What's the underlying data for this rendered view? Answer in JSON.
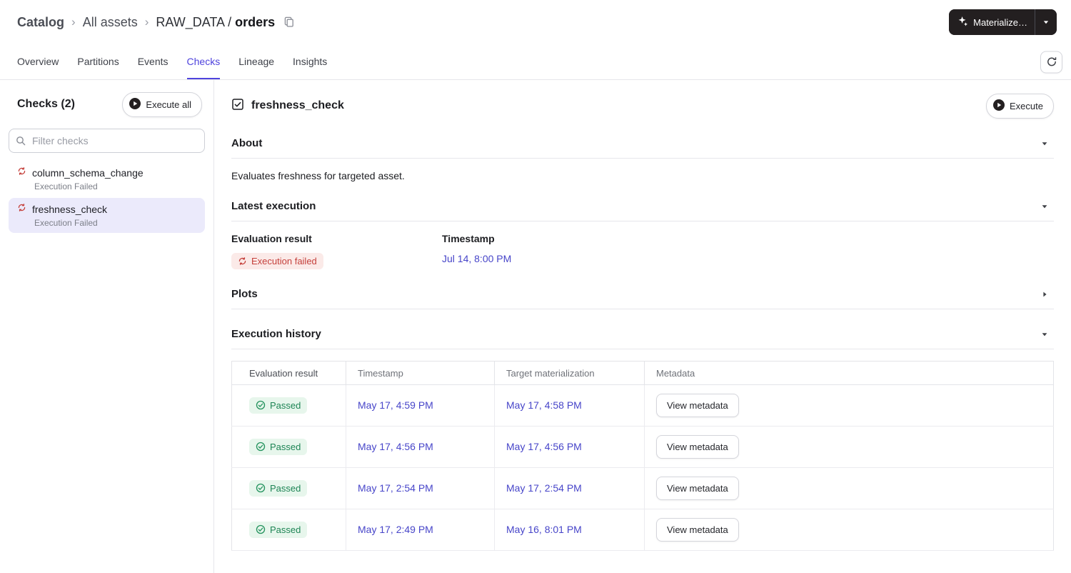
{
  "breadcrumb": {
    "catalog": "Catalog",
    "all_assets": "All assets",
    "asset_prefix": "RAW_DATA /",
    "asset_name": "orders"
  },
  "header": {
    "materialize_label": "Materialize…"
  },
  "tabs": [
    {
      "label": "Overview",
      "active": false
    },
    {
      "label": "Partitions",
      "active": false
    },
    {
      "label": "Events",
      "active": false
    },
    {
      "label": "Checks",
      "active": true
    },
    {
      "label": "Lineage",
      "active": false
    },
    {
      "label": "Insights",
      "active": false
    }
  ],
  "sidebar": {
    "title": "Checks (2)",
    "execute_all_label": "Execute all",
    "filter_placeholder": "Filter checks",
    "items": [
      {
        "name": "column_schema_change",
        "status": "Execution Failed",
        "selected": false
      },
      {
        "name": "freshness_check",
        "status": "Execution Failed",
        "selected": true
      }
    ]
  },
  "main": {
    "title": "freshness_check",
    "execute_label": "Execute",
    "about": {
      "title": "About",
      "description": "Evaluates freshness for targeted asset."
    },
    "latest_execution": {
      "title": "Latest execution",
      "result_label": "Evaluation result",
      "result_value": "Execution failed",
      "timestamp_label": "Timestamp",
      "timestamp_value": "Jul 14, 8:00 PM"
    },
    "plots": {
      "title": "Plots"
    },
    "execution_history": {
      "title": "Execution history",
      "columns": [
        "Evaluation result",
        "Timestamp",
        "Target materialization",
        "Metadata"
      ],
      "rows": [
        {
          "result": "Passed",
          "timestamp": "May 17, 4:59 PM",
          "target": "May 17, 4:58 PM",
          "metadata_label": "View metadata"
        },
        {
          "result": "Passed",
          "timestamp": "May 17, 4:56 PM",
          "target": "May 17, 4:56 PM",
          "metadata_label": "View metadata"
        },
        {
          "result": "Passed",
          "timestamp": "May 17, 2:54 PM",
          "target": "May 17, 2:54 PM",
          "metadata_label": "View metadata"
        },
        {
          "result": "Passed",
          "timestamp": "May 17, 2:49 PM",
          "target": "May 16, 8:01 PM",
          "metadata_label": "View metadata"
        }
      ]
    }
  },
  "colors": {
    "accent_blue": "#4F43DD",
    "link_blue": "#4745C9",
    "failed_red": "#C5413C",
    "failed_bg": "#FBEAE8",
    "passed_green": "#1E8555",
    "passed_bg": "#E7F6EC",
    "selected_bg": "#EBEAFB",
    "dark_button": "#231F20"
  }
}
